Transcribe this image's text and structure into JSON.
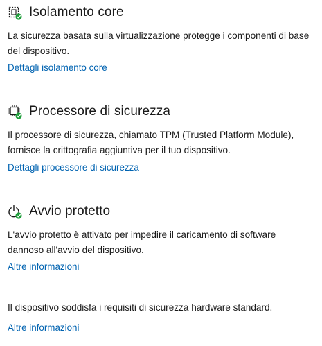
{
  "sections": [
    {
      "title": "Isolamento core",
      "icon": "core-isolation-icon",
      "description_lines": [
        "La sicurezza basata sulla virtualizzazione protegge i componenti di base",
        "del dispositivo."
      ],
      "link": "Dettagli isolamento core"
    },
    {
      "title": "Processore di sicurezza",
      "icon": "security-processor-icon",
      "description_lines": [
        "Il processore di sicurezza, chiamato TPM (Trusted Platform Module),",
        "fornisce la crittografia aggiuntiva per il tuo dispositivo."
      ],
      "link": "Dettagli processore di sicurezza"
    },
    {
      "title": "Avvio protetto",
      "icon": "secure-boot-icon",
      "description_lines": [
        "L'avvio protetto è attivato per impedire il caricamento di software",
        "dannoso all'avvio del dispositivo."
      ],
      "link": "Altre informazioni"
    }
  ],
  "footer": {
    "status": "Il dispositivo soddisfa i requisiti di sicurezza hardware standard.",
    "link": "Altre informazioni"
  },
  "colors": {
    "link": "#0063b1",
    "check_badge": "#1e9e3a",
    "icon_stroke": "#1a1a1a"
  }
}
